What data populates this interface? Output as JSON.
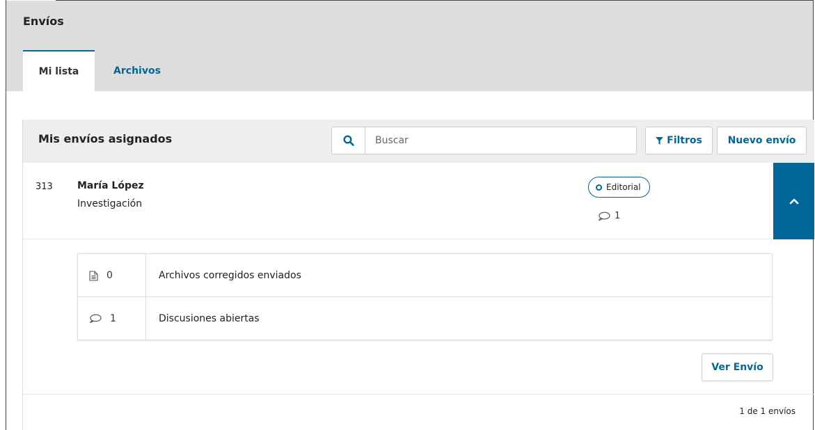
{
  "header": {
    "title": "Envíos",
    "tabs": [
      {
        "label": "Mi lista",
        "active": true
      },
      {
        "label": "Archivos",
        "active": false
      }
    ]
  },
  "panel": {
    "title": "Mis envíos asignados",
    "search": {
      "placeholder": "Buscar",
      "value": "",
      "icon": "search-icon"
    },
    "filters_label": "Filtros",
    "new_submission_label": "Nuevo envío"
  },
  "submission": {
    "id": "313",
    "author": "María López",
    "title": "Investigación",
    "stage": "Editorial",
    "comments": "1",
    "details": [
      {
        "icon": "file-icon",
        "count": "0",
        "label": "Archivos corregidos enviados"
      },
      {
        "icon": "comment-icon",
        "count": "1",
        "label": "Discusiones abiertas"
      }
    ],
    "view_label": "Ver Envío"
  },
  "pagination": "1 de 1 envíos",
  "colors": {
    "accent": "#006798",
    "header_bg": "#dddddd",
    "panel_head_bg": "#eeeeee"
  }
}
